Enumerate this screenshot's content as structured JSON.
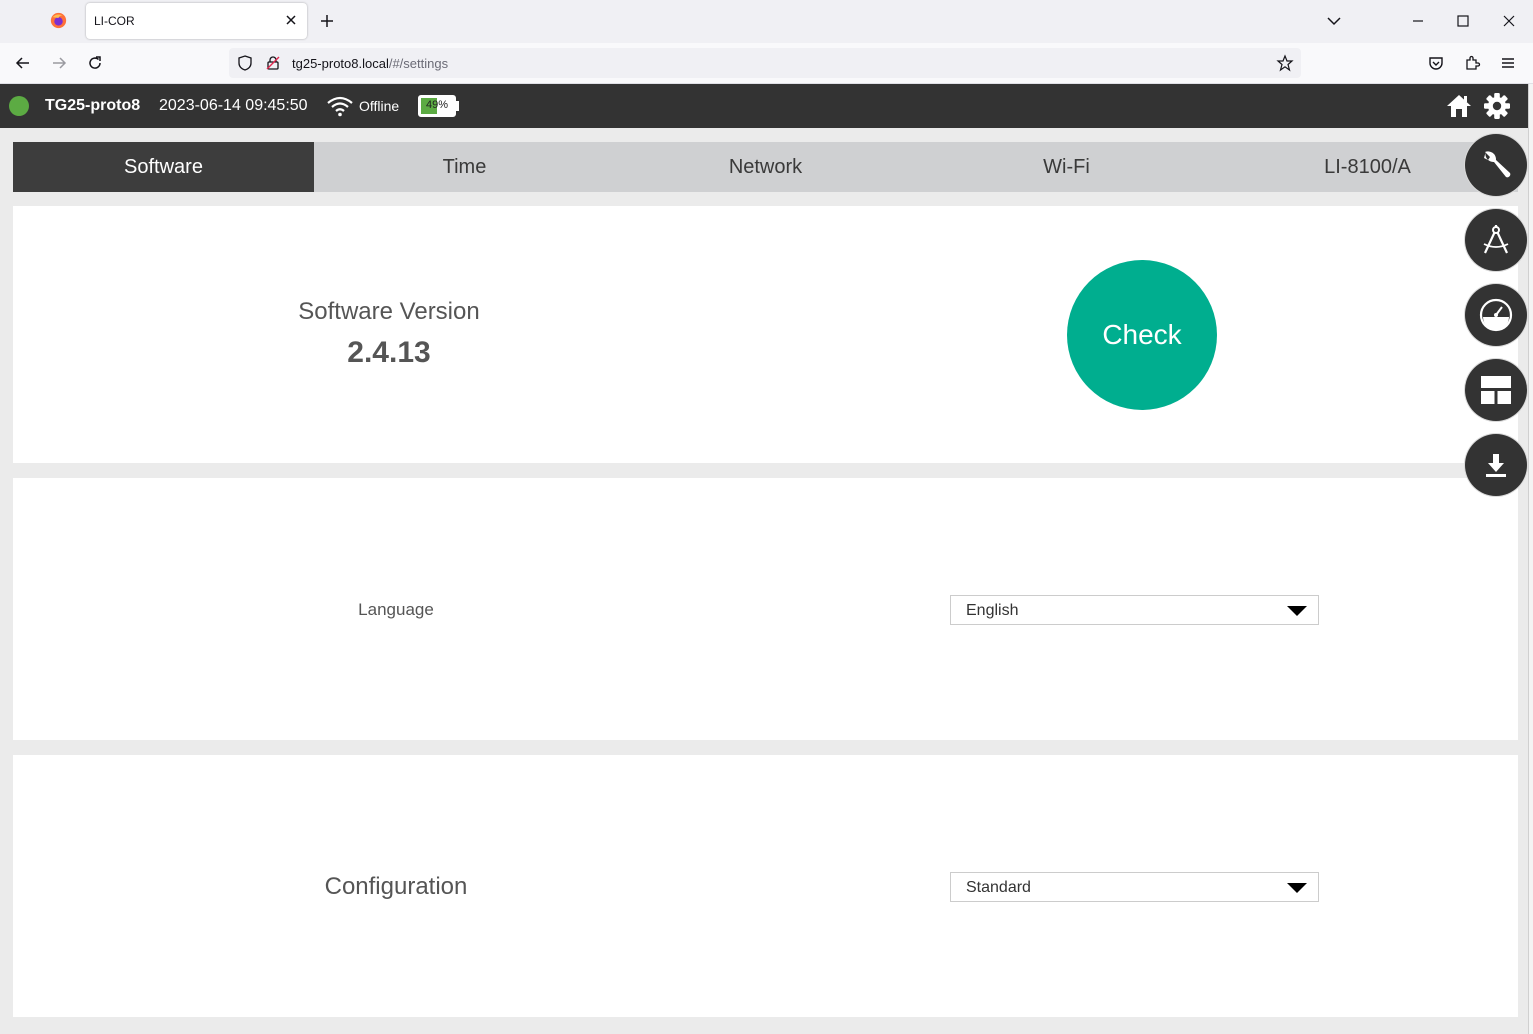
{
  "browser": {
    "tab_title": "LI-COR",
    "url_host": "tg25-proto8.local",
    "url_path": "/#/settings",
    "icons": [
      "firefox-icon",
      "close-icon",
      "plus-icon",
      "chevron-down-icon",
      "minimize-icon",
      "maximize-icon",
      "close-window-icon",
      "back-icon",
      "forward-icon",
      "reload-icon",
      "shield-icon",
      "lock-icon",
      "star-icon",
      "pocket-icon",
      "extensions-icon",
      "menu-icon"
    ]
  },
  "header": {
    "device_name": "TG25-proto8",
    "datetime": "2023-06-14 09:45:50",
    "connection_status": "Offline",
    "battery_label": "49%",
    "battery_level": 0.49,
    "status_color": "#5cab43"
  },
  "tabs": [
    {
      "label": "Software",
      "active": true
    },
    {
      "label": "Time",
      "active": false
    },
    {
      "label": "Network",
      "active": false
    },
    {
      "label": "Wi-Fi",
      "active": false
    },
    {
      "label": "LI-8100/A",
      "active": false
    }
  ],
  "software": {
    "version_label": "Software Version",
    "version_value": "2.4.13",
    "check_label": "Check",
    "check_color": "#00ae8f"
  },
  "language": {
    "label": "Language",
    "selected": "English"
  },
  "configuration": {
    "label": "Configuration",
    "selected": "Standard"
  },
  "fabs": [
    "wrench-icon",
    "compass-icon",
    "gauge-icon",
    "layout-icon",
    "download-icon"
  ]
}
